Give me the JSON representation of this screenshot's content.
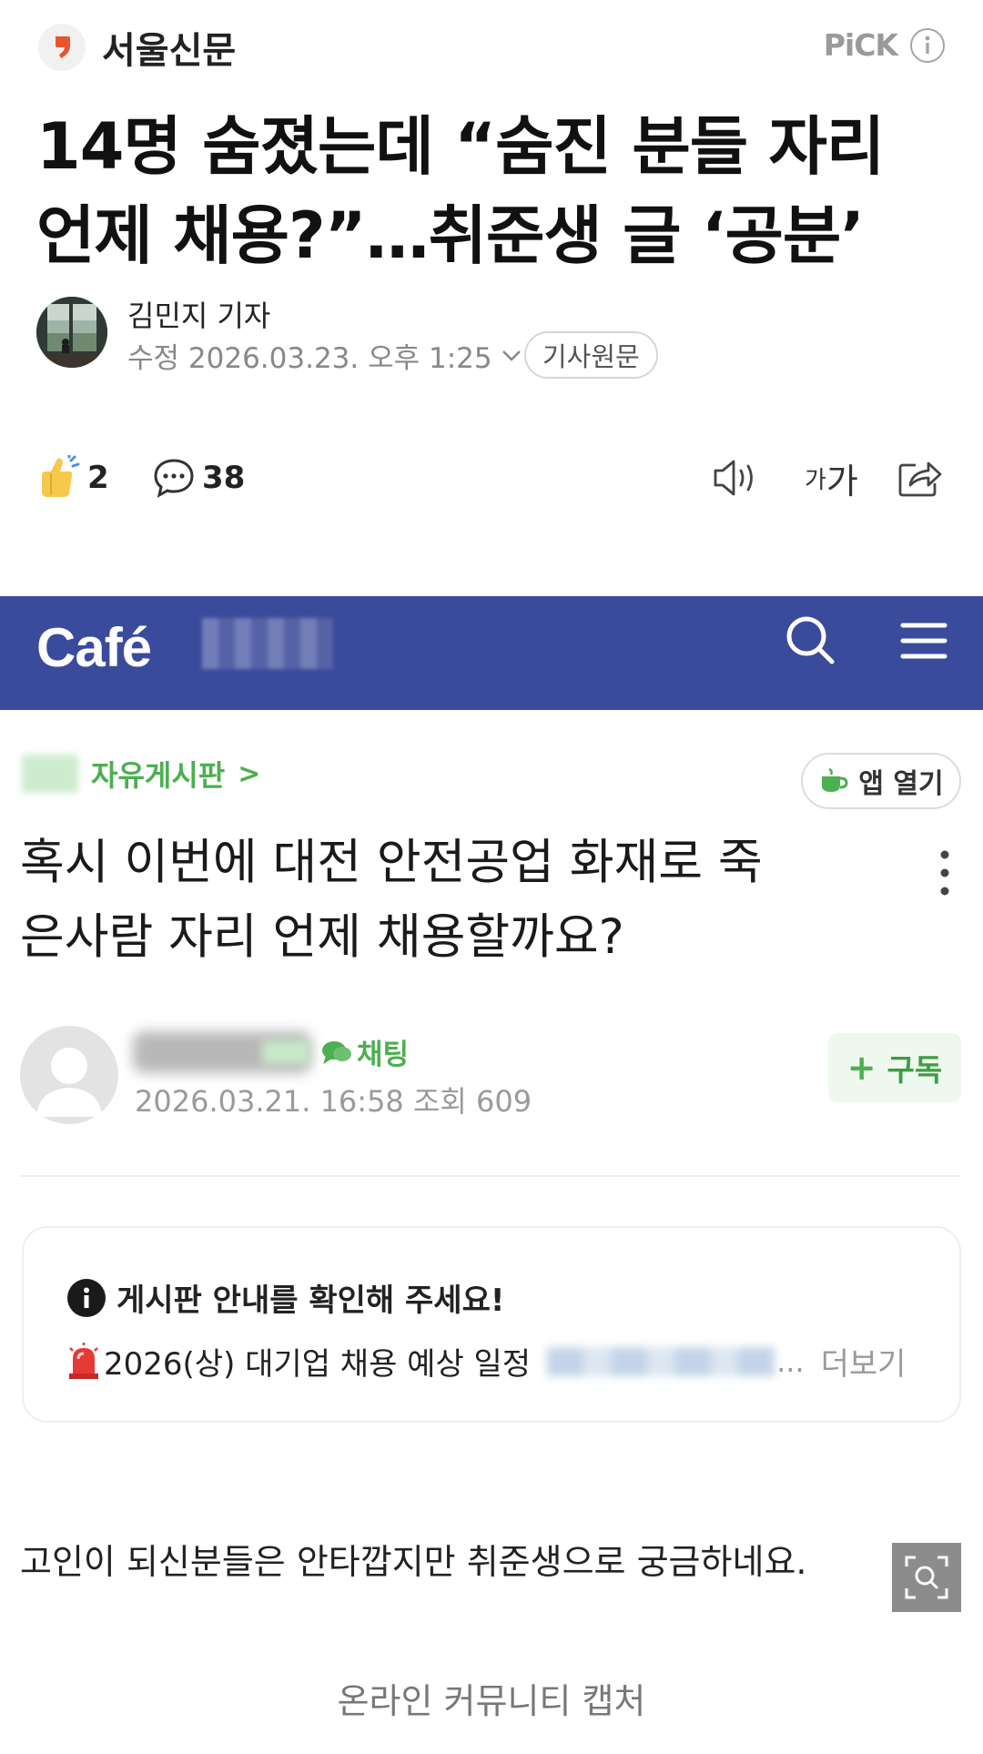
{
  "press": {
    "name": "서울신문",
    "pick_label": "PiCK",
    "logo_color": "#e8552b"
  },
  "article": {
    "headline_line1": "14명 숨졌는데 “숨진 분들 자리",
    "headline_line2": "언제 채용?”…취준생 글 ‘공분’",
    "reporter": "김민지 기자",
    "modified_label": "수정",
    "modified_datetime": "2026.03.23. 오후 1:25",
    "original_button": "기사원문"
  },
  "actions": {
    "like_count": "2",
    "comment_count": "38",
    "font_small": "가",
    "font_big": "가"
  },
  "capture": {
    "cafe_logo": "Café",
    "header_color": "#3b4b9b",
    "board_name": "자유게시판",
    "board_arrow": ">",
    "app_open": "앱 열기",
    "post_title_line1": "혹시 이번에 대전 안전공업 화재로 죽",
    "post_title_line2": "은사람 자리 언제 채용할까요?",
    "chat_label": "채팅",
    "post_meta": "2026.03.21. 16:58 조회 609",
    "subscribe_plus": "+",
    "subscribe_label": "구독",
    "notice_title": "게시판 안내를 확인해 주세요!",
    "notice_item": "2026(상) 대기업 채용 예상 일정",
    "notice_ellipsis": "...",
    "notice_more": "더보기",
    "post_body": "고인이 되신분들은 안타깝지만 취준생으로 궁금하네요.",
    "accent_green": "#4caf50"
  },
  "caption": "온라인 커뮤니티 캡처"
}
